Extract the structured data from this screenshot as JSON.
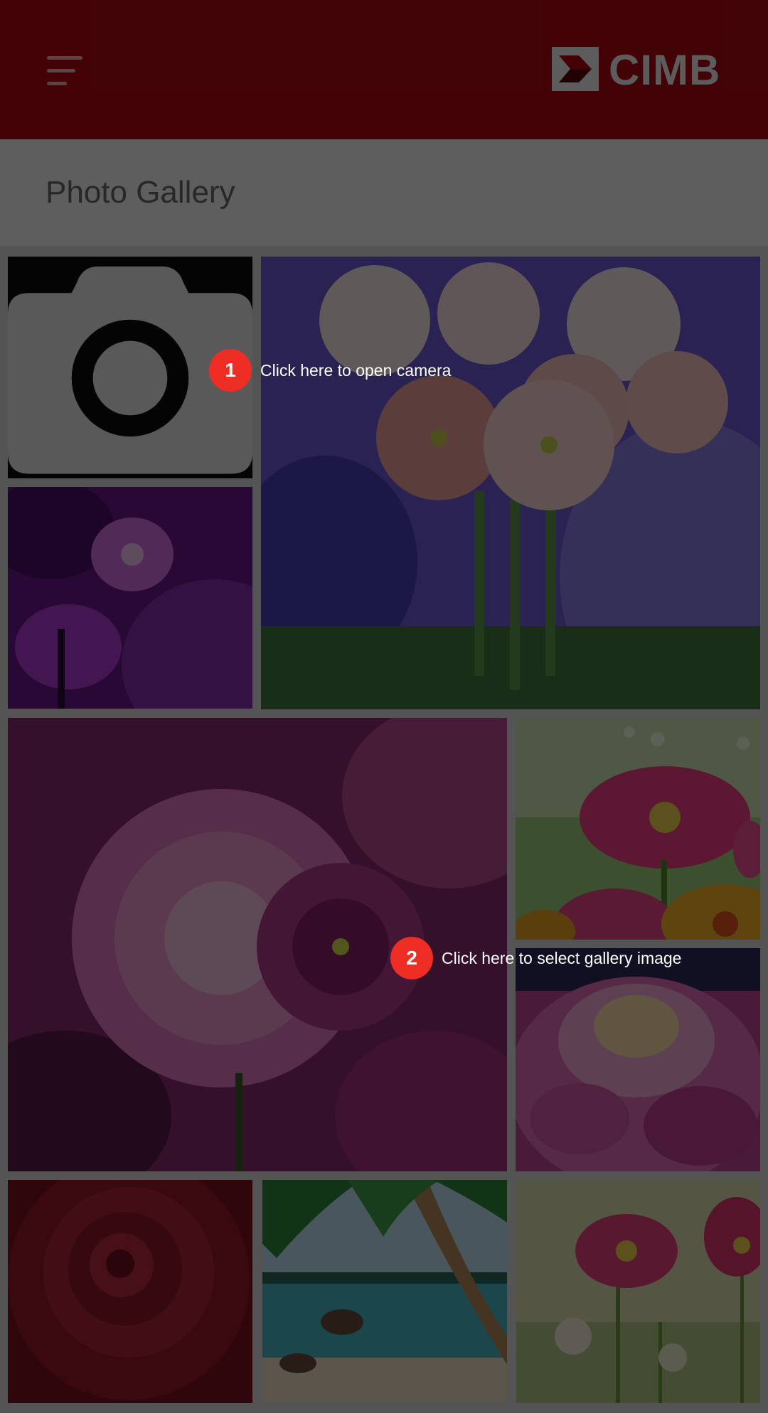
{
  "header": {
    "menu_icon": "hamburger-menu-icon",
    "logo_text": "CIMB",
    "brand_color": "#b10a12"
  },
  "page": {
    "title": "Photo Gallery"
  },
  "gallery": {
    "camera_icon": "camera-icon",
    "images": [
      "purple-flower-photo",
      "pink-primrose-photo",
      "pink-dahlia-photo",
      "pink-gerbera-photo",
      "pink-dahlia-closeup-photo",
      "red-rose-photo",
      "tropical-beach-photo",
      "pink-cosmos-photo"
    ]
  },
  "coach_marks": [
    {
      "number": "1",
      "text": "Click here to open camera"
    },
    {
      "number": "2",
      "text": "Click here to select gallery image"
    }
  ],
  "overlay_color": "rgba(0,0,0,0.62)"
}
